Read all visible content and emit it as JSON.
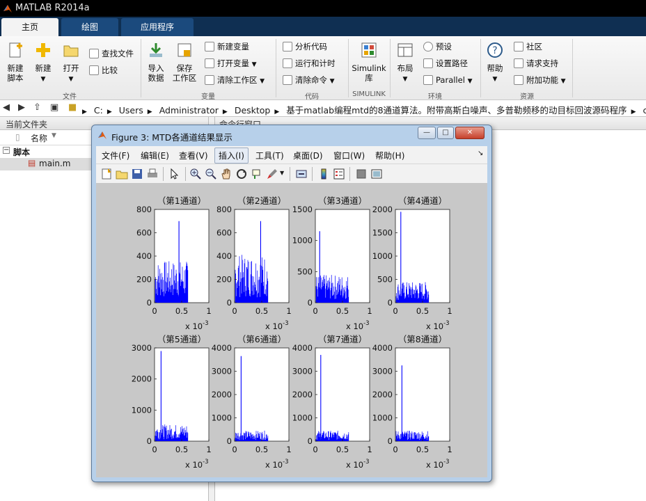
{
  "app": {
    "title": "MATLAB R2014a"
  },
  "tabs": [
    {
      "label": "主页"
    },
    {
      "label": "绘图"
    },
    {
      "label": "应用程序"
    }
  ],
  "ribbon": {
    "file": {
      "new_script": "新建\n脚本",
      "new": "新建",
      "open": "打开",
      "find_files": "查找文件",
      "compare": "比较",
      "group": "文件"
    },
    "variable": {
      "import": "导入\n数据",
      "save": "保存\n工作区",
      "new_variable": "新建变量",
      "open_variable": "打开变量",
      "clear_workspace": "清除工作区",
      "group": "变量"
    },
    "code": {
      "analyze": "分析代码",
      "run_time": "运行和计时",
      "clear_commands": "清除命令",
      "group": "代码"
    },
    "simulink": {
      "library": "Simulink\n库",
      "group": "SIMULINK"
    },
    "environment": {
      "layout": "布局",
      "preferences": "预设",
      "set_path": "设置路径",
      "parallel": "Parallel",
      "group": "环境"
    },
    "resources": {
      "help": "帮助",
      "community": "社区",
      "support": "请求支持",
      "addons": "附加功能",
      "group": "资源"
    }
  },
  "breadcrumb": [
    "C:",
    "Users",
    "Administrator",
    "Desktop",
    "基于matlab编程mtd的8通道算法。附带高斯白噪声、多普勒频移的动目标回波源码程序",
    "code"
  ],
  "current_folder": {
    "title": "当前文件夹",
    "col_name": "名称",
    "group": "脚本",
    "file": "main.m"
  },
  "command_window": {
    "title": "命令行窗口"
  },
  "figure": {
    "title": "Figure 3: MTD各通道结果显示",
    "menus": [
      "文件(F)",
      "编辑(E)",
      "查看(V)",
      "插入(I)",
      "工具(T)",
      "桌面(D)",
      "窗口(W)",
      "帮助(H)"
    ],
    "active_menu_index": 3
  },
  "chart_data": [
    {
      "type": "bar",
      "title": "（第1通道）",
      "xlim": [
        0,
        1
      ],
      "ylim": [
        0,
        800
      ],
      "yticks": [
        0,
        200,
        400,
        600,
        800
      ],
      "xticks": [
        0,
        0.5,
        1
      ],
      "x_exponent": "x 10-3",
      "x_extent": [
        0,
        0.62
      ],
      "baseline": 200,
      "peak": {
        "x": 0.45,
        "y": 700
      }
    },
    {
      "type": "bar",
      "title": "（第2通道）",
      "xlim": [
        0,
        1
      ],
      "ylim": [
        0,
        800
      ],
      "yticks": [
        0,
        200,
        400,
        600,
        800
      ],
      "xticks": [
        0,
        0.5,
        1
      ],
      "x_exponent": "x 10-3",
      "x_extent": [
        0,
        0.62
      ],
      "baseline": 230,
      "peak": {
        "x": 0.48,
        "y": 700
      }
    },
    {
      "type": "bar",
      "title": "（第3通道）",
      "xlim": [
        0,
        1
      ],
      "ylim": [
        0,
        1500
      ],
      "yticks": [
        0,
        500,
        1000,
        1500
      ],
      "xticks": [
        0,
        0.5,
        1
      ],
      "x_exponent": "x 10-3",
      "x_extent": [
        0,
        0.62
      ],
      "baseline": 250,
      "peak": {
        "x": 0.08,
        "y": 1150
      }
    },
    {
      "type": "bar",
      "title": "（第4通道）",
      "xlim": [
        0,
        1
      ],
      "ylim": [
        0,
        2000
      ],
      "yticks": [
        0,
        500,
        1000,
        1500,
        2000
      ],
      "xticks": [
        0,
        0.5,
        1
      ],
      "x_exponent": "x 10-3",
      "x_extent": [
        0,
        0.62
      ],
      "baseline": 250,
      "peak": {
        "x": 0.1,
        "y": 1950
      }
    },
    {
      "type": "bar",
      "title": "（第5通道）",
      "xlim": [
        0,
        1
      ],
      "ylim": [
        0,
        3000
      ],
      "yticks": [
        0,
        1000,
        2000,
        3000
      ],
      "xticks": [
        0,
        0.5,
        1
      ],
      "x_exponent": "x 10-3",
      "x_extent": [
        0,
        0.62
      ],
      "baseline": 300,
      "peak": {
        "x": 0.12,
        "y": 2900
      }
    },
    {
      "type": "bar",
      "title": "（第6通道）",
      "xlim": [
        0,
        1
      ],
      "ylim": [
        0,
        4000
      ],
      "yticks": [
        0,
        1000,
        2000,
        3000,
        4000
      ],
      "xticks": [
        0,
        0.5,
        1
      ],
      "x_exponent": "x 10-3",
      "x_extent": [
        0,
        0.62
      ],
      "baseline": 250,
      "peak": {
        "x": 0.12,
        "y": 3650
      }
    },
    {
      "type": "bar",
      "title": "（第7通道）",
      "xlim": [
        0,
        1
      ],
      "ylim": [
        0,
        4000
      ],
      "yticks": [
        0,
        1000,
        2000,
        3000,
        4000
      ],
      "xticks": [
        0,
        0.5,
        1
      ],
      "x_exponent": "x 10-3",
      "x_extent": [
        0,
        0.62
      ],
      "baseline": 250,
      "peak": {
        "x": 0.1,
        "y": 3700
      }
    },
    {
      "type": "bar",
      "title": "（第8通道）",
      "xlim": [
        0,
        1
      ],
      "ylim": [
        0,
        4000
      ],
      "yticks": [
        0,
        1000,
        2000,
        3000,
        4000
      ],
      "xticks": [
        0,
        0.5,
        1
      ],
      "x_exponent": "x 10-3",
      "x_extent": [
        0,
        0.62
      ],
      "baseline": 250,
      "peak": {
        "x": 0.12,
        "y": 3250
      }
    }
  ],
  "colors": {
    "series": "#0000ff",
    "plot_bg": "#c8c8c8",
    "tab_bar": "#0f2f52"
  }
}
